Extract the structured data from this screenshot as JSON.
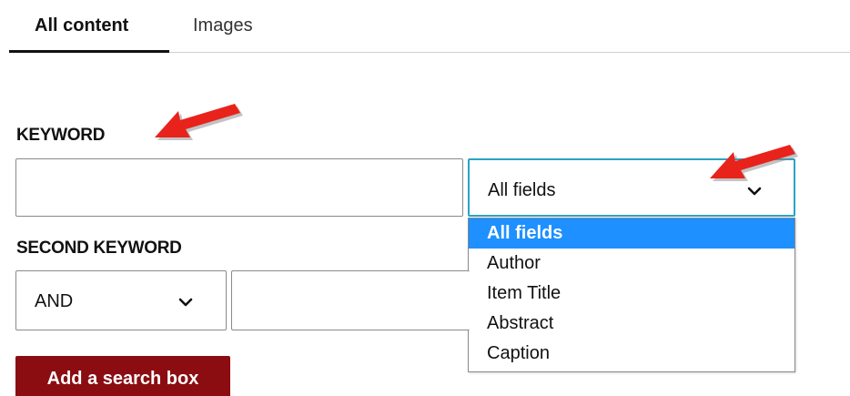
{
  "tabs": [
    {
      "label": "All content",
      "active": true
    },
    {
      "label": "Images",
      "active": false
    }
  ],
  "form": {
    "keyword_label": "KEYWORD",
    "keyword_value": "",
    "field_select": {
      "value": "All fields",
      "options": [
        "All fields",
        "Author",
        "Item Title",
        "Abstract",
        "Caption"
      ],
      "open": true,
      "highlighted": "All fields"
    },
    "second_keyword_label": "SECOND KEYWORD",
    "operator_select": {
      "value": "AND"
    },
    "second_keyword_value": "",
    "add_button_label": "Add a search box"
  },
  "annotations": {
    "arrow_color": "#e8231b",
    "arrow_count": 2
  },
  "colors": {
    "focus_border": "#2aa3c2",
    "selected_option": "#1e90ff",
    "button_bg": "#8b0d12"
  }
}
